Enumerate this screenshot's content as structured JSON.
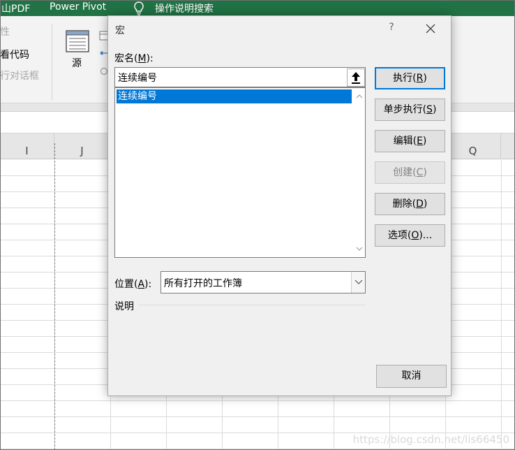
{
  "excel": {
    "ribbon_tabs": [
      "山PDF",
      "Power Pivot",
      "操作说明搜索"
    ],
    "ribbon_left_items": [
      "性",
      "看代码",
      "行对话框"
    ],
    "source_button_label": "源",
    "column_headers": [
      "I",
      "J",
      "Q"
    ],
    "accent_color": "#217346"
  },
  "dialog": {
    "title": "宏",
    "help_label": "?",
    "macro_name_label": "宏名(M):",
    "macro_name_value": "连续编号",
    "macro_list": [
      "连续编号"
    ],
    "selected_macro_index": 0,
    "buttons": [
      {
        "label": "执行(R)",
        "state": "default"
      },
      {
        "label": "单步执行(S)",
        "state": "normal"
      },
      {
        "label": "编辑(E)",
        "state": "normal"
      },
      {
        "label": "创建(C)",
        "state": "disabled"
      },
      {
        "label": "删除(D)",
        "state": "normal"
      },
      {
        "label": "选项(O)...",
        "state": "normal"
      }
    ],
    "location_label": "位置(A):",
    "location_value": "所有打开的工作簿",
    "description_label": "说明",
    "cancel_label": "取消",
    "selection_color": "#0078d7"
  },
  "watermark": "https://blog.csdn.net/lis66450"
}
